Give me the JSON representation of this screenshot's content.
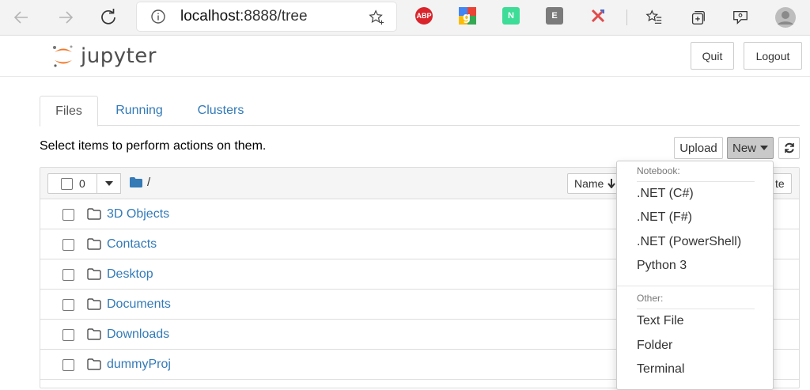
{
  "browser": {
    "url_scheme_host": "localhost",
    "url_rest": ":8888/tree",
    "extensions": [
      {
        "name": "adblock-plus-icon",
        "label": "ABP",
        "color": "#d9242b"
      },
      {
        "name": "google-translate-icon",
        "label": "",
        "color": "#4285f4"
      },
      {
        "name": "notion-ext-icon",
        "label": "N",
        "color": "#3ddc97"
      },
      {
        "name": "e-ext-icon",
        "label": "E",
        "color": "#7b7b7b"
      },
      {
        "name": "x-ext-icon",
        "label": "",
        "color": "#e04b4b"
      }
    ]
  },
  "header": {
    "logo_text": "jupyter",
    "quit_label": "Quit",
    "logout_label": "Logout"
  },
  "tabs": [
    {
      "label": "Files",
      "active": true
    },
    {
      "label": "Running",
      "active": false
    },
    {
      "label": "Clusters",
      "active": false
    }
  ],
  "toolbar": {
    "select_text": "Select items to perform actions on them.",
    "upload_label": "Upload",
    "new_label": "New"
  },
  "list": {
    "selected_count": "0",
    "breadcrumb": "/",
    "sort_label": "Name",
    "last_modified_partial": "te",
    "items": [
      {
        "name": "3D Objects"
      },
      {
        "name": "Contacts"
      },
      {
        "name": "Desktop"
      },
      {
        "name": "Documents"
      },
      {
        "name": "Downloads"
      },
      {
        "name": "dummyProj"
      }
    ]
  },
  "new_menu": {
    "notebook_header": "Notebook:",
    "notebook_items": [
      ".NET (C#)",
      ".NET (F#)",
      ".NET (PowerShell)",
      "Python 3"
    ],
    "other_header": "Other:",
    "other_items": [
      "Text File",
      "Folder",
      "Terminal"
    ]
  },
  "colors": {
    "link": "#337ab7",
    "jupyter_orange": "#f37726"
  }
}
